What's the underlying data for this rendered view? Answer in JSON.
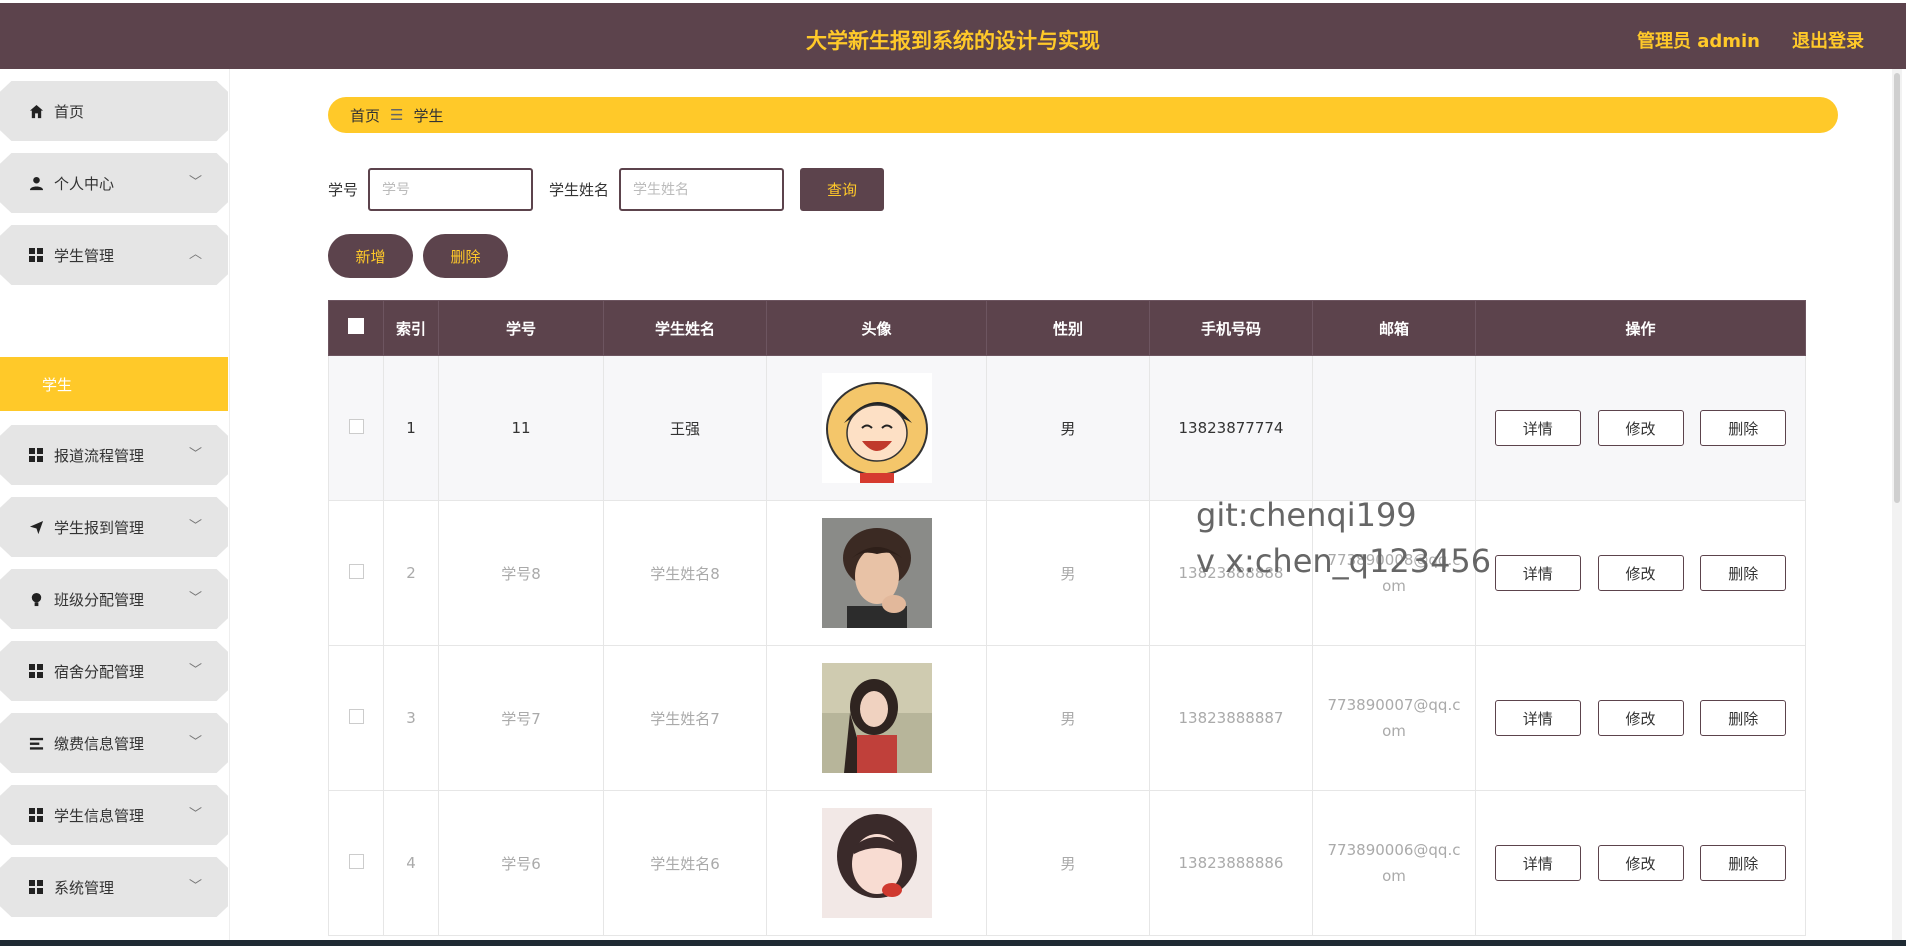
{
  "header": {
    "title": "大学新生报到系统的设计与实现",
    "user_label": "管理员 admin",
    "logout_label": "退出登录"
  },
  "sidebar": {
    "items": [
      {
        "label": "首页",
        "icon": "home-icon"
      },
      {
        "label": "个人中心",
        "icon": "user-icon"
      },
      {
        "label": "学生管理",
        "icon": "grid-icon"
      },
      {
        "label": "报道流程管理",
        "icon": "grid-icon"
      },
      {
        "label": "学生报到管理",
        "icon": "send-icon"
      },
      {
        "label": "班级分配管理",
        "icon": "bulb-icon"
      },
      {
        "label": "宿舍分配管理",
        "icon": "grid-icon"
      },
      {
        "label": "缴费信息管理",
        "icon": "list-icon"
      },
      {
        "label": "学生信息管理",
        "icon": "grid-icon"
      },
      {
        "label": "系统管理",
        "icon": "grid-icon"
      }
    ],
    "active_sub": "学生"
  },
  "breadcrumb": {
    "home": "首页",
    "separator": "☰",
    "current": "学生"
  },
  "search": {
    "id_label": "学号",
    "id_placeholder": "学号",
    "name_label": "学生姓名",
    "name_placeholder": "学生姓名",
    "query_label": "查询"
  },
  "actions": {
    "add_label": "新增",
    "delete_label": "删除"
  },
  "table": {
    "headers": [
      "索引",
      "学号",
      "学生姓名",
      "头像",
      "性别",
      "手机号码",
      "邮箱",
      "操作"
    ],
    "rows": [
      {
        "index": "1",
        "sid": "11",
        "name": "王强",
        "gender": "男",
        "phone": "13823877774",
        "email": ""
      },
      {
        "index": "2",
        "sid": "学号8",
        "name": "学生姓名8",
        "gender": "男",
        "phone": "13823888888",
        "email": "773890008@qq.com"
      },
      {
        "index": "3",
        "sid": "学号7",
        "name": "学生姓名7",
        "gender": "男",
        "phone": "13823888887",
        "email": "773890007@qq.com"
      },
      {
        "index": "4",
        "sid": "学号6",
        "name": "学生姓名6",
        "gender": "男",
        "phone": "13823888886",
        "email": "773890006@qq.com"
      }
    ],
    "op_detail": "详情",
    "op_edit": "修改",
    "op_delete": "删除"
  },
  "watermark": {
    "line1": "git:chenqi199",
    "line2": "v x:chen_q123456"
  },
  "colors": {
    "primary": "#5c434c",
    "accent": "#ffc929"
  }
}
